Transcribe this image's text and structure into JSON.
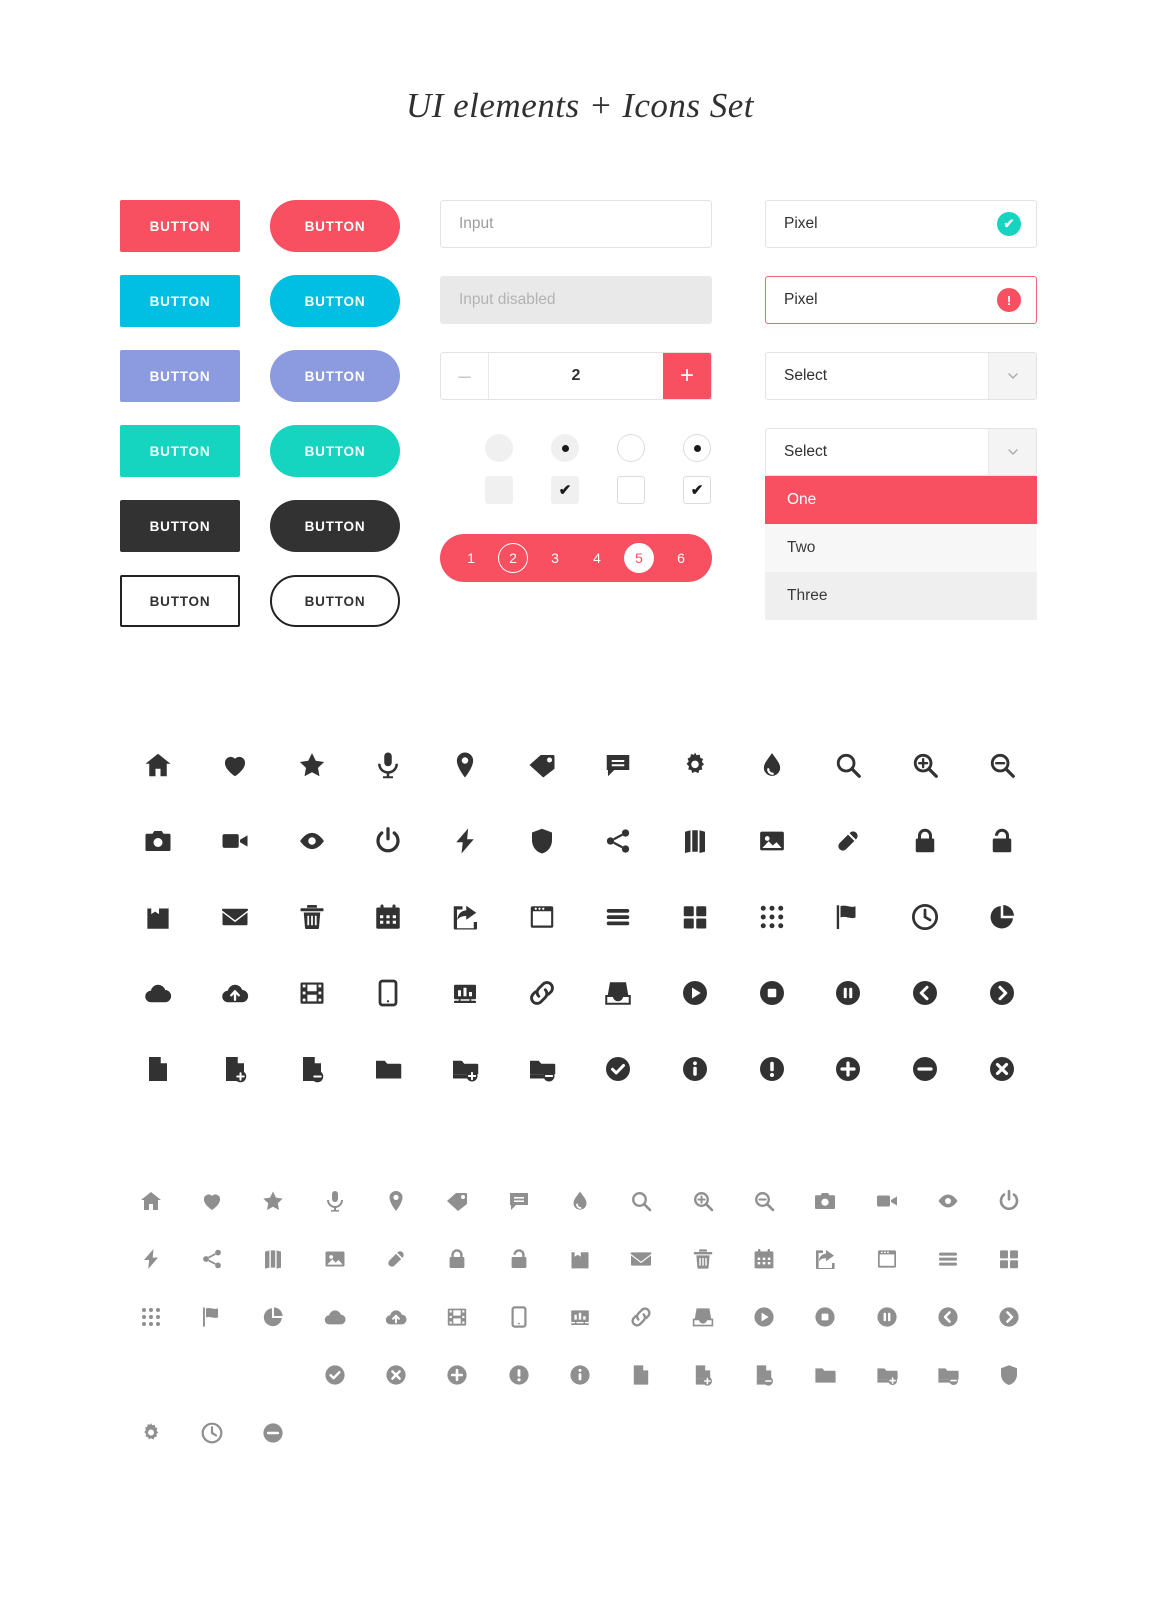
{
  "page": {
    "title": "UI elements + Icons Set"
  },
  "colors": {
    "red": "#f84f61",
    "blue": "#00bfe3",
    "periwinkle": "#8c9ae0",
    "teal": "#15d4c0",
    "dark": "#323232",
    "white": "#ffffff",
    "border": "#e3e3e3",
    "disabled_bg": "#e9e9e9",
    "icon_dark": "#323232",
    "icon_gray": "#8f8f8f"
  },
  "buttons": {
    "label": "BUTTON",
    "rows": [
      {
        "color_name": "red",
        "class": "c-red"
      },
      {
        "color_name": "blue",
        "class": "c-blue"
      },
      {
        "color_name": "periwinkle",
        "class": "c-peri"
      },
      {
        "color_name": "teal",
        "class": "c-teal"
      },
      {
        "color_name": "dark",
        "class": "c-dark"
      },
      {
        "color_name": "outline",
        "class": "c-ghost"
      }
    ]
  },
  "inputs": {
    "text_placeholder": "Input",
    "disabled_placeholder": "Input disabled",
    "stepper": {
      "minus": "–",
      "value": "2",
      "plus": "+"
    }
  },
  "choices": {
    "radio_filled_empty": "",
    "radio_filled_checked": "•",
    "radio_outline_empty": "",
    "radio_outline_checked": "•",
    "check_filled_empty": "",
    "check_filled_checked": "✔",
    "check_outline_empty": "",
    "check_outline_checked": "✔"
  },
  "pagination": {
    "pages": [
      {
        "label": "1",
        "state": "plain"
      },
      {
        "label": "2",
        "state": "ring"
      },
      {
        "label": "3",
        "state": "plain"
      },
      {
        "label": "4",
        "state": "plain"
      },
      {
        "label": "5",
        "state": "solid"
      },
      {
        "label": "6",
        "state": "plain"
      }
    ]
  },
  "selects": {
    "pixel_success": {
      "value": "Pixel",
      "badge": "✔",
      "badge_type": "ok"
    },
    "pixel_error": {
      "value": "Pixel",
      "badge": "!",
      "badge_type": "err"
    },
    "select_closed": {
      "value": "Select"
    },
    "select_open": {
      "value": "Select"
    },
    "options": [
      {
        "label": "One",
        "state": "selected"
      },
      {
        "label": "Two",
        "state": "normal"
      },
      {
        "label": "Three",
        "state": "alt"
      }
    ]
  },
  "icon_set_dark": {
    "columns": 12,
    "names": [
      "home-icon",
      "heart-icon",
      "star-icon",
      "microphone-icon",
      "location-pin-icon",
      "tag-icon",
      "chat-bubble-icon",
      "gear-icon",
      "water-drop-icon",
      "search-icon",
      "zoom-in-icon",
      "zoom-out-icon",
      "camera-icon",
      "video-camera-icon",
      "eye-icon",
      "power-icon",
      "lightning-bolt-icon",
      "shield-icon",
      "share-icon",
      "columns-icon",
      "image-icon",
      "pill-icon",
      "lock-closed-icon",
      "lock-open-icon",
      "book-icon",
      "envelope-icon",
      "trash-icon",
      "calendar-icon",
      "share-arrow-icon",
      "browser-window-icon",
      "list-icon",
      "grid-squares-icon",
      "grid-dots-icon",
      "flag-icon",
      "clock-icon",
      "pie-chart-icon",
      "cloud-icon",
      "cloud-upload-icon",
      "film-icon",
      "tablet-icon",
      "bar-chart-icon",
      "link-icon",
      "inbox-icon",
      "play-circle-icon",
      "stop-circle-icon",
      "pause-circle-icon",
      "chevron-left-circle-icon",
      "chevron-right-circle-icon",
      "file-icon",
      "file-add-icon",
      "file-remove-icon",
      "folder-icon",
      "folder-add-icon",
      "folder-remove-icon",
      "check-circle-icon",
      "info-circle-icon",
      "exclamation-circle-icon",
      "plus-circle-icon",
      "minus-circle-icon",
      "close-circle-icon"
    ]
  },
  "icon_set_gray": {
    "columns": 15,
    "names": [
      "home-icon",
      "heart-icon",
      "star-icon",
      "microphone-icon",
      "location-pin-icon",
      "tag-icon",
      "chat-bubble-icon",
      "water-drop-icon",
      "search-icon",
      "zoom-in-icon",
      "zoom-out-icon",
      "camera-icon",
      "video-camera-icon",
      "eye-icon",
      "power-icon",
      "lightning-bolt-icon",
      "share-icon",
      "columns-icon",
      "image-icon",
      "pill-icon",
      "lock-closed-icon",
      "lock-open-icon",
      "book-icon",
      "envelope-icon",
      "trash-icon",
      "calendar-icon",
      "share-arrow-icon",
      "browser-window-icon",
      "list-icon",
      "grid-squares-icon",
      "grid-dots-icon",
      "flag-icon",
      "pie-chart-icon",
      "cloud-icon",
      "cloud-upload-icon",
      "film-icon",
      "tablet-icon",
      "bar-chart-icon",
      "link-icon",
      "inbox-icon",
      "play-circle-icon",
      "stop-circle-icon",
      "pause-circle-icon",
      "chevron-left-circle-icon",
      "chevron-right-circle-icon",
      "check-circle-icon",
      "close-circle-icon",
      "plus-circle-icon",
      "exclamation-circle-icon",
      "info-circle-icon",
      "file-icon",
      "file-add-icon",
      "file-remove-icon",
      "folder-icon",
      "folder-add-icon",
      "folder-remove-icon",
      "shield-icon",
      "gear-icon",
      "clock-icon",
      "minus-circle-icon"
    ]
  }
}
